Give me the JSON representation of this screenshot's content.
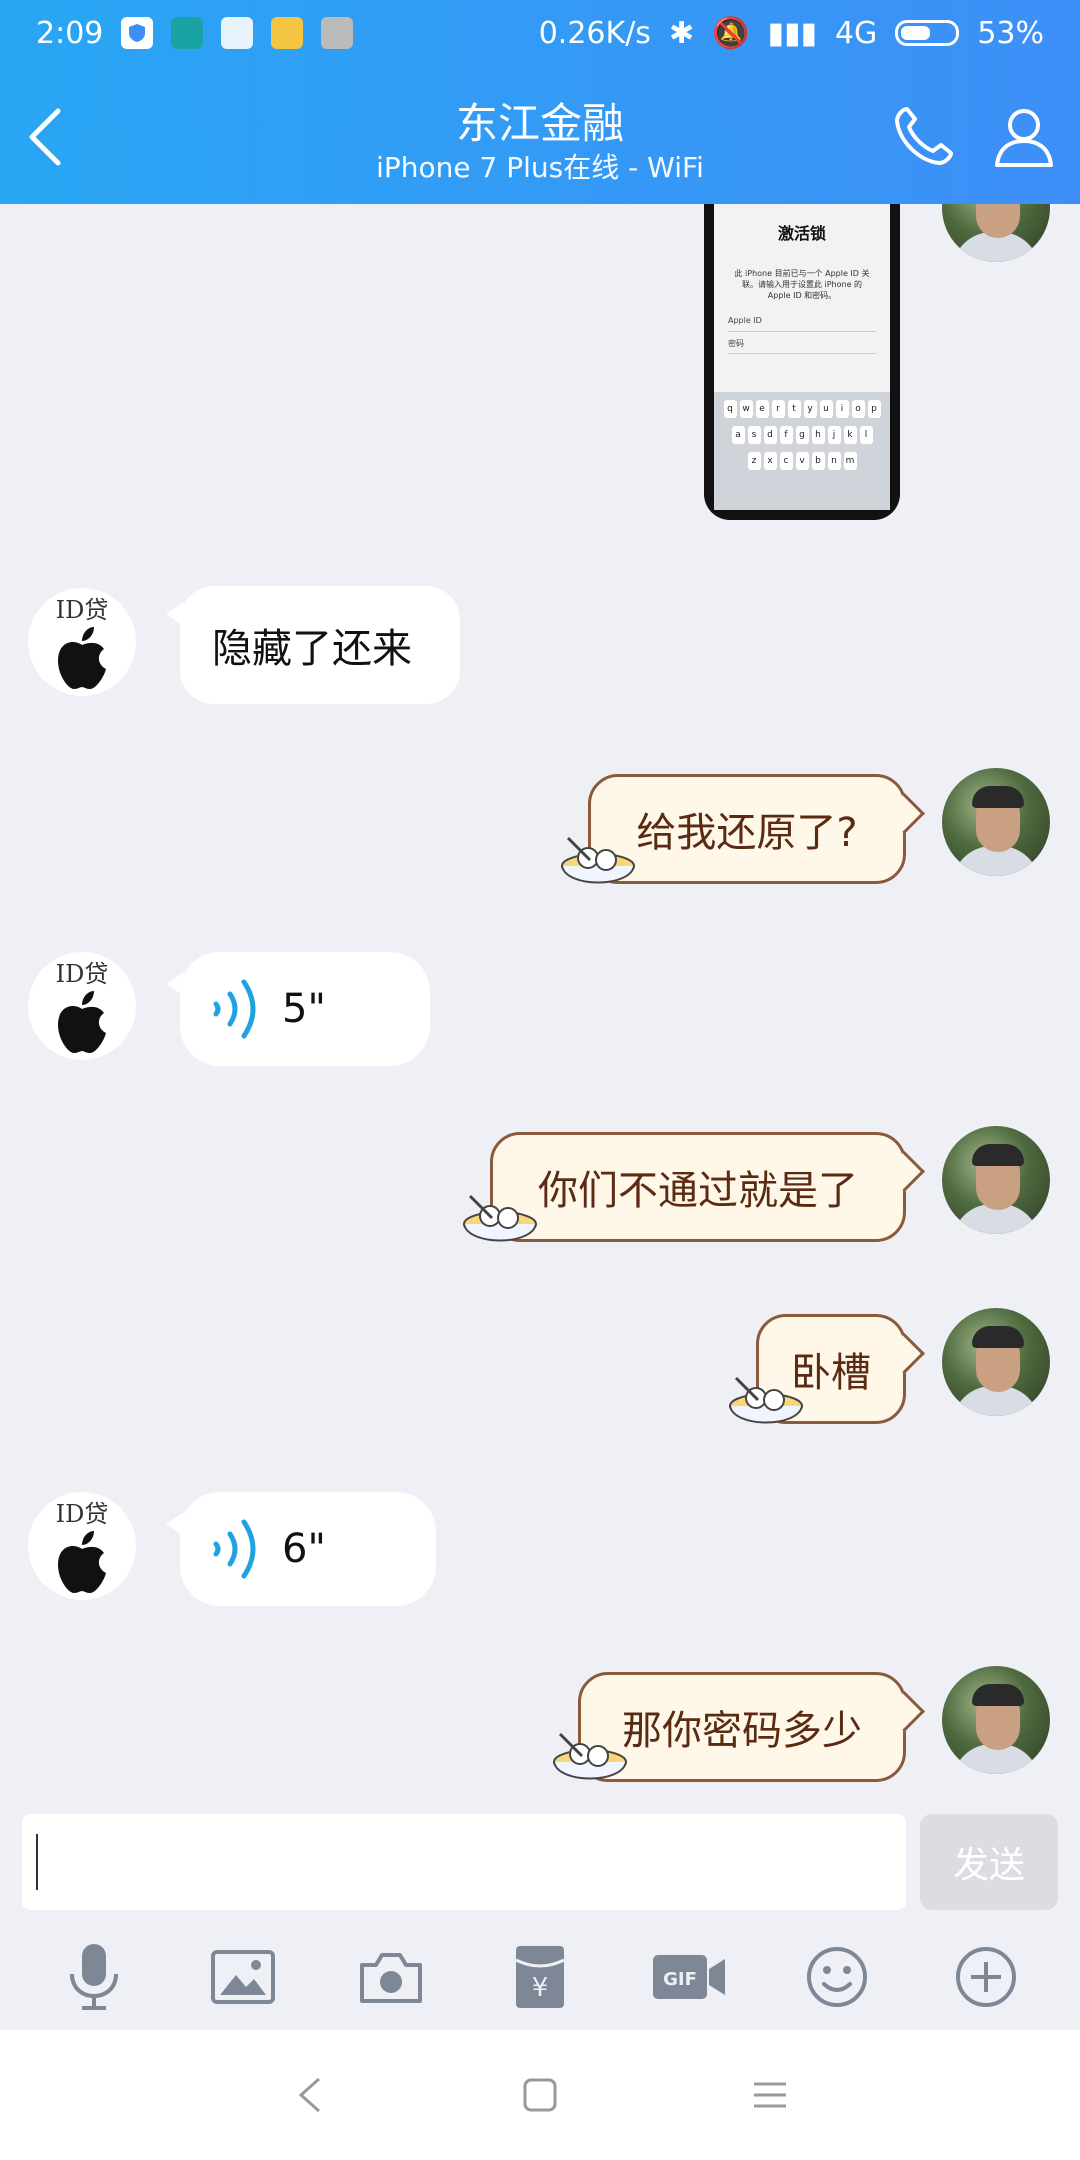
{
  "status_bar": {
    "time": "2:09",
    "network_speed": "0.26K/s",
    "network_type": "4G",
    "battery": "53%"
  },
  "header": {
    "title": "东江金融",
    "subtitle": "iPhone 7 Plus在线 - WiFi"
  },
  "phone_screenshot": {
    "title": "激活锁",
    "body": "此 iPhone 目前已与一个 Apple ID 关联。请输入用于设置此 iPhone 的 Apple ID 和密码。",
    "appleid_label": "Apple ID",
    "password_label": "密码",
    "keyboard_rows": [
      [
        "q",
        "w",
        "e",
        "r",
        "t",
        "y",
        "u",
        "i",
        "o",
        "p"
      ],
      [
        "a",
        "s",
        "d",
        "f",
        "g",
        "h",
        "j",
        "k",
        "l"
      ],
      [
        "z",
        "x",
        "c",
        "v",
        "b",
        "n",
        "m"
      ]
    ]
  },
  "messages": [
    {
      "side": "left",
      "text": "隐藏了还来"
    },
    {
      "side": "right",
      "text": "给我还原了?"
    },
    {
      "side": "left",
      "type": "voice",
      "duration": "5\""
    },
    {
      "side": "right",
      "text": "你们不通过就是了"
    },
    {
      "side": "right",
      "text": "卧槽"
    },
    {
      "side": "left",
      "type": "voice",
      "duration": "6\""
    },
    {
      "side": "right",
      "text": "那你密码多少"
    }
  ],
  "contact_avatar_label": "ID贷",
  "input": {
    "value": "",
    "send_label": "发送"
  }
}
